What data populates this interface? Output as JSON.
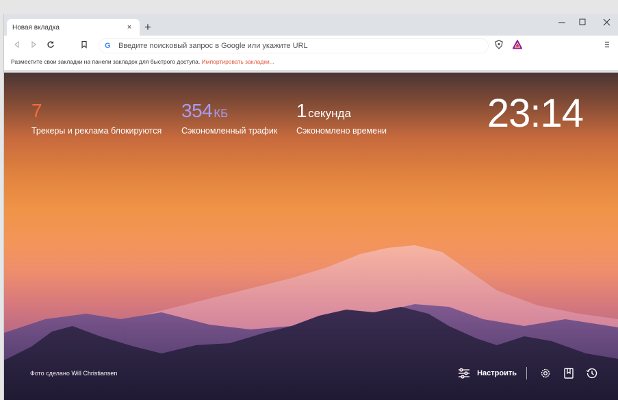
{
  "tab": {
    "title": "Новая вкладка",
    "close": "×"
  },
  "new_tab_label": "+",
  "window_controls": {
    "minimize": "—",
    "maximize": "☐",
    "close": "✕"
  },
  "omnibox": {
    "placeholder": "Введите поисковый запрос в Google или укажите URL",
    "engine_letter": "G"
  },
  "bookmarks_bar": {
    "text": "Разместите свои закладки на панели закладок для быстрого доступа.",
    "link": "Импортировать закладки..."
  },
  "stats": {
    "trackers": {
      "value": "7",
      "label": "Трекеры и реклама блокируются",
      "color": "#f36b3b"
    },
    "bandwidth": {
      "value": "354",
      "unit": "КБ",
      "label": "Сэкономленный трафик",
      "color": "#a69cf3"
    },
    "time": {
      "value": "1",
      "unit": "секунда",
      "label": "Сэкономлено времени",
      "color": "#ffffff"
    }
  },
  "clock": "23:14",
  "photo_credit": {
    "prefix": "Фото сделано",
    "author": "Will Christiansen"
  },
  "footer": {
    "customize_label": "Настроить"
  },
  "icons": [
    "back-icon",
    "forward-icon",
    "reload-icon",
    "bookmark-icon",
    "brave-shield-icon",
    "brave-rewards-icon",
    "menu-icon",
    "customize-icon",
    "settings-icon",
    "bookmarks-icon",
    "history-icon"
  ]
}
